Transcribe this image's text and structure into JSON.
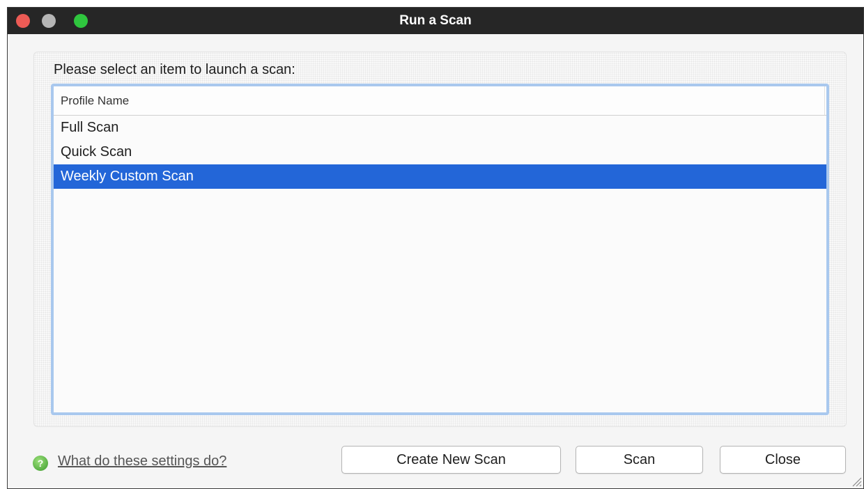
{
  "window": {
    "title": "Run a Scan",
    "controls": [
      "close-button",
      "minimize-button",
      "zoom-button"
    ]
  },
  "prompt": "Please select an item to launch a scan:",
  "list": {
    "column_header": "Profile Name",
    "items": [
      "Full Scan",
      "Quick Scan",
      "Weekly Custom Scan"
    ],
    "selected_index": 2
  },
  "help": {
    "icon": "question-circle-icon",
    "link_text": "What do these settings do?"
  },
  "buttons": {
    "create": "Create New Scan",
    "scan": "Scan",
    "close": "Close"
  },
  "colors": {
    "selection": "#2366d8",
    "focus_ring": "#a9c8ee",
    "titlebar": "#262626"
  }
}
